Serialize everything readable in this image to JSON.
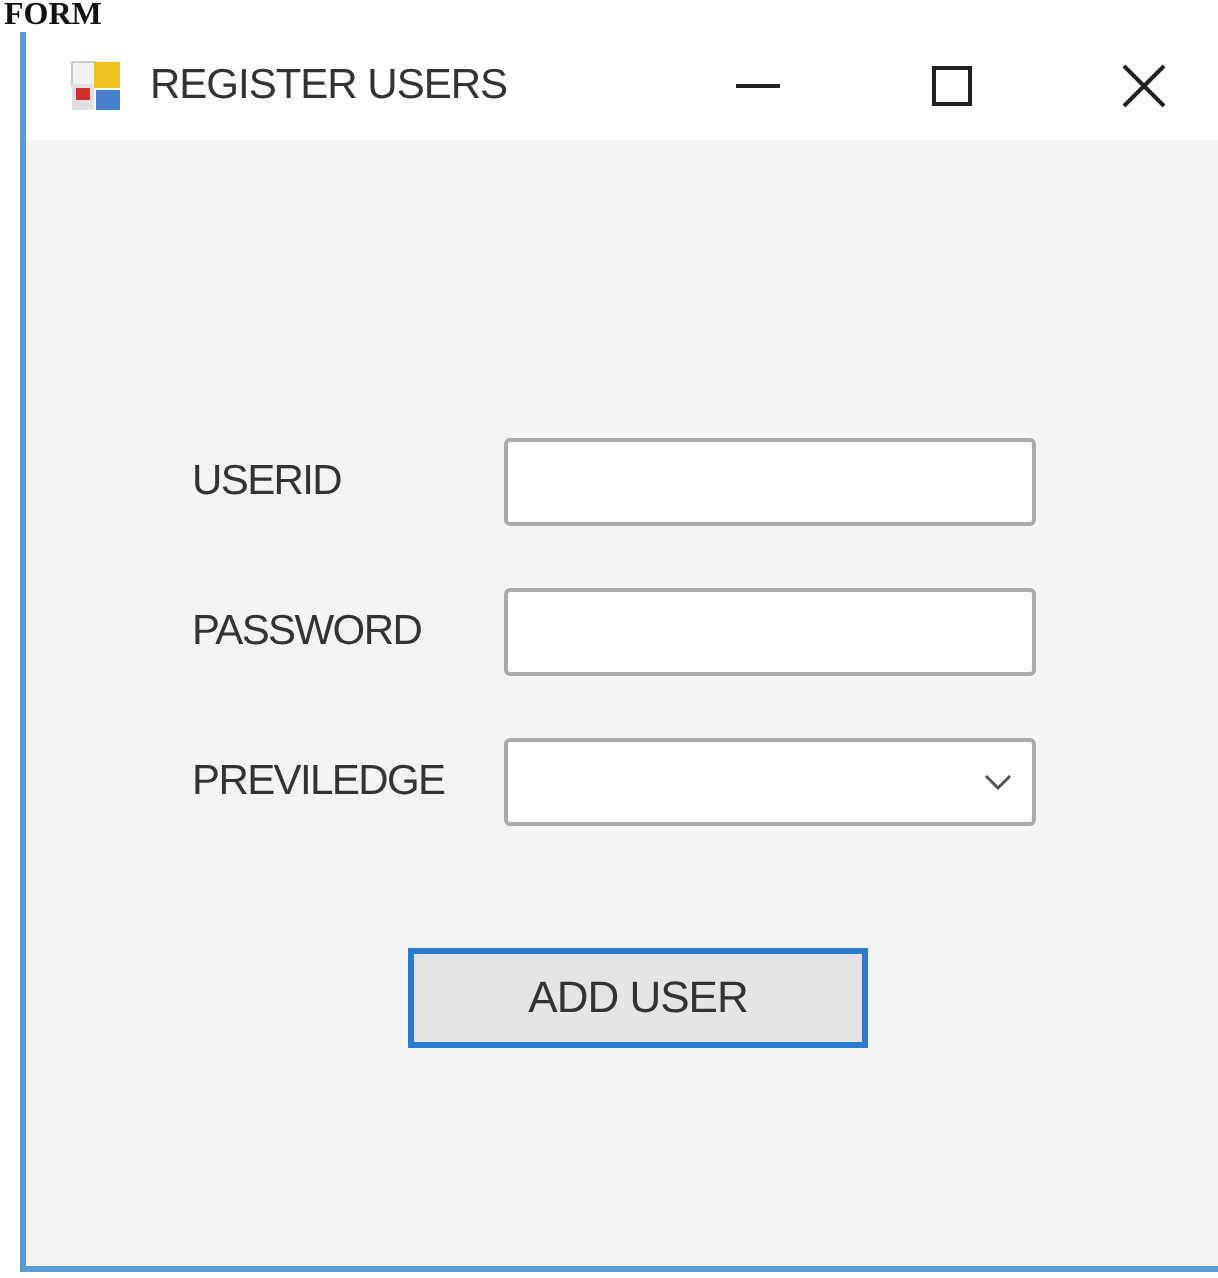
{
  "page": {
    "heading": "FORM"
  },
  "window": {
    "title": "REGISTER USERS"
  },
  "fields": [
    {
      "label": "USERID",
      "kind": "text"
    },
    {
      "label": "PASSWORD",
      "kind": "text"
    },
    {
      "label": "PREVILEDGE",
      "kind": "dropdown"
    }
  ],
  "buttons": [
    {
      "label": "ADD USER",
      "focused": true
    }
  ]
}
